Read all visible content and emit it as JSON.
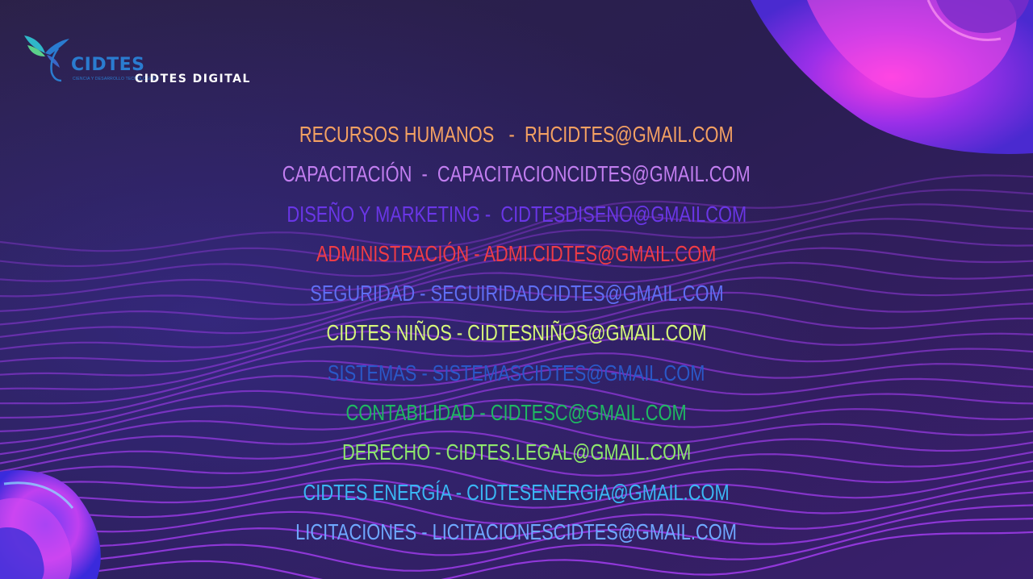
{
  "header": {
    "logo_word": "CIDTES",
    "logo_tagline": "CIENCIA Y DESARROLLO TECNOLÓGICO",
    "brand_label": "CIDTES DIGITAL"
  },
  "contacts": [
    {
      "text": "RECURSOS HUMANOS   -  RHCIDTES@GMAIL.COM",
      "color": "#f4a162"
    },
    {
      "text": "CAPACITACIÓN  -  CAPACITACIONCIDTES@GMAIL.COM",
      "color": "#c27ef0"
    },
    {
      "text": "DISEÑO Y MARKETING -  CIDTESDISENO@GMAILCOM",
      "color": "#6a36e6"
    },
    {
      "text": "ADMINISTRACIÓN - ADMI.CIDTES@GMAIL.COM",
      "color": "#f03c46"
    },
    {
      "text": "SEGURIDAD - SEGUIRIDADCIDTES@GMAIL.COM",
      "color": "#5f6ef4"
    },
    {
      "text": "CIDTES NIÑOS - CIDTESNIÑOS@GMAIL.COM",
      "color": "#d6f77a"
    },
    {
      "text": "SISTEMAS - SISTEMASCIDTES@GMAIL.COM",
      "color": "#2a58c8"
    },
    {
      "text": "CONTABILIDAD - CIDTESC@GMAIL.COM",
      "color": "#1fb862"
    },
    {
      "text": "DERECHO - CIDTES.LEGAL@GMAIL.COM",
      "color": "#8ee86c"
    },
    {
      "text": "CIDTES ENERGÍA - CIDTESENERGIA@GMAIL.COM",
      "color": "#3ab7f4"
    },
    {
      "text": "LICITACIONES - LICITACIONESCIDTES@GMAIL.COM",
      "color": "#6ea8ff"
    }
  ],
  "icons": [
    "hummingbird-logo-icon"
  ],
  "colors": {
    "background": "#2a1f4a",
    "wave_lines": "#a33cf0",
    "blob_accent": "#c640f0"
  }
}
